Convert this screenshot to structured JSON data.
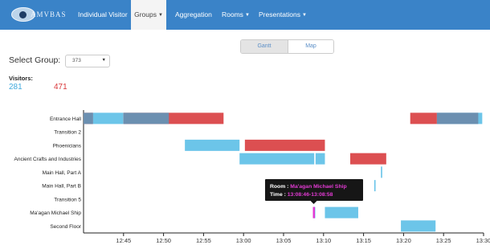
{
  "navbar": {
    "brand": "AMVBAS",
    "items": [
      {
        "label": "Individual Visitor",
        "caret": false,
        "active": false
      },
      {
        "label": "Groups",
        "caret": true,
        "active": true
      },
      {
        "label": "Aggregation",
        "caret": false,
        "active": false
      },
      {
        "label": "Rooms",
        "caret": true,
        "active": false
      },
      {
        "label": "Presentations",
        "caret": true,
        "active": false
      }
    ]
  },
  "view_toggle": {
    "gantt": "Gantt",
    "map": "Map",
    "selected": "Gantt"
  },
  "select_group": {
    "label": "Select Group:",
    "value": "373"
  },
  "visitors": {
    "label": "Visitors:",
    "a": "281",
    "b": "471"
  },
  "colors": {
    "navbar": "#3a83c8",
    "visitor_a": "#6cc5e9",
    "visitor_b": "#dc4f51",
    "overlap": "#6b8fb0",
    "highlight": "#e23ad3"
  },
  "tooltip": {
    "room_label": "Room : ",
    "room": "Ma'agan Michael Ship",
    "time_label": "Time : ",
    "time": "13:08:46-13:08:58"
  },
  "chart_data": {
    "type": "gantt",
    "time_ticks": [
      "12:45",
      "12:50",
      "12:55",
      "13:00",
      "13:05",
      "13:10",
      "13:15",
      "13:20",
      "13:25",
      "13:30"
    ],
    "x_range": [
      "12:40",
      "13:30"
    ],
    "rows": [
      "Entrance Hall",
      "Transition 2",
      "Phoenicians",
      "Ancient Crafts and Industries",
      "Main Hall, Part A",
      "Main Hall, Part B",
      "Transition 5",
      "Ma'agan Michael Ship",
      "Second Floor"
    ],
    "series": [
      {
        "name": "281",
        "bars": [
          {
            "row": "Entrance Hall",
            "start": "12:40:50",
            "end": "12:45:00"
          },
          {
            "row": "Entrance Hall",
            "start": "13:24:10",
            "end": "13:29:50"
          },
          {
            "row": "Phoenicians",
            "start": "12:52:40",
            "end": "12:59:30"
          },
          {
            "row": "Ancient Crafts and Industries",
            "start": "12:59:30",
            "end": "13:08:50"
          },
          {
            "row": "Ancient Crafts and Industries",
            "start": "13:09:00",
            "end": "13:10:10"
          },
          {
            "row": "Main Hall, Part A",
            "start": "13:17:10",
            "end": "13:17:20"
          },
          {
            "row": "Main Hall, Part B",
            "start": "13:16:20",
            "end": "13:16:30"
          },
          {
            "row": "Ma'agan Michael Ship",
            "start": "13:08:46",
            "end": "13:08:58"
          },
          {
            "row": "Ma'agan Michael Ship",
            "start": "13:10:10",
            "end": "13:14:20"
          },
          {
            "row": "Second Floor",
            "start": "13:19:40",
            "end": "13:24:00"
          }
        ]
      },
      {
        "name": "471",
        "bars": [
          {
            "row": "Entrance Hall",
            "start": "12:40:00",
            "end": "12:41:10"
          },
          {
            "row": "Entrance Hall",
            "start": "12:45:00",
            "end": "12:57:30"
          },
          {
            "row": "Entrance Hall",
            "start": "13:20:50",
            "end": "13:24:10"
          },
          {
            "row": "Phoenicians",
            "start": "13:00:10",
            "end": "13:10:10"
          },
          {
            "row": "Ancient Crafts and Industries",
            "start": "13:13:20",
            "end": "13:17:50"
          }
        ]
      },
      {
        "name": "overlap",
        "bars": [
          {
            "row": "Entrance Hall",
            "start": "12:40:00",
            "end": "12:41:10"
          },
          {
            "row": "Entrance Hall",
            "start": "12:45:00",
            "end": "12:50:40"
          },
          {
            "row": "Entrance Hall",
            "start": "13:24:10",
            "end": "13:29:20"
          }
        ]
      }
    ],
    "highlight": {
      "row": "Ma'agan Michael Ship",
      "start": "13:08:46",
      "end": "13:08:58"
    }
  }
}
